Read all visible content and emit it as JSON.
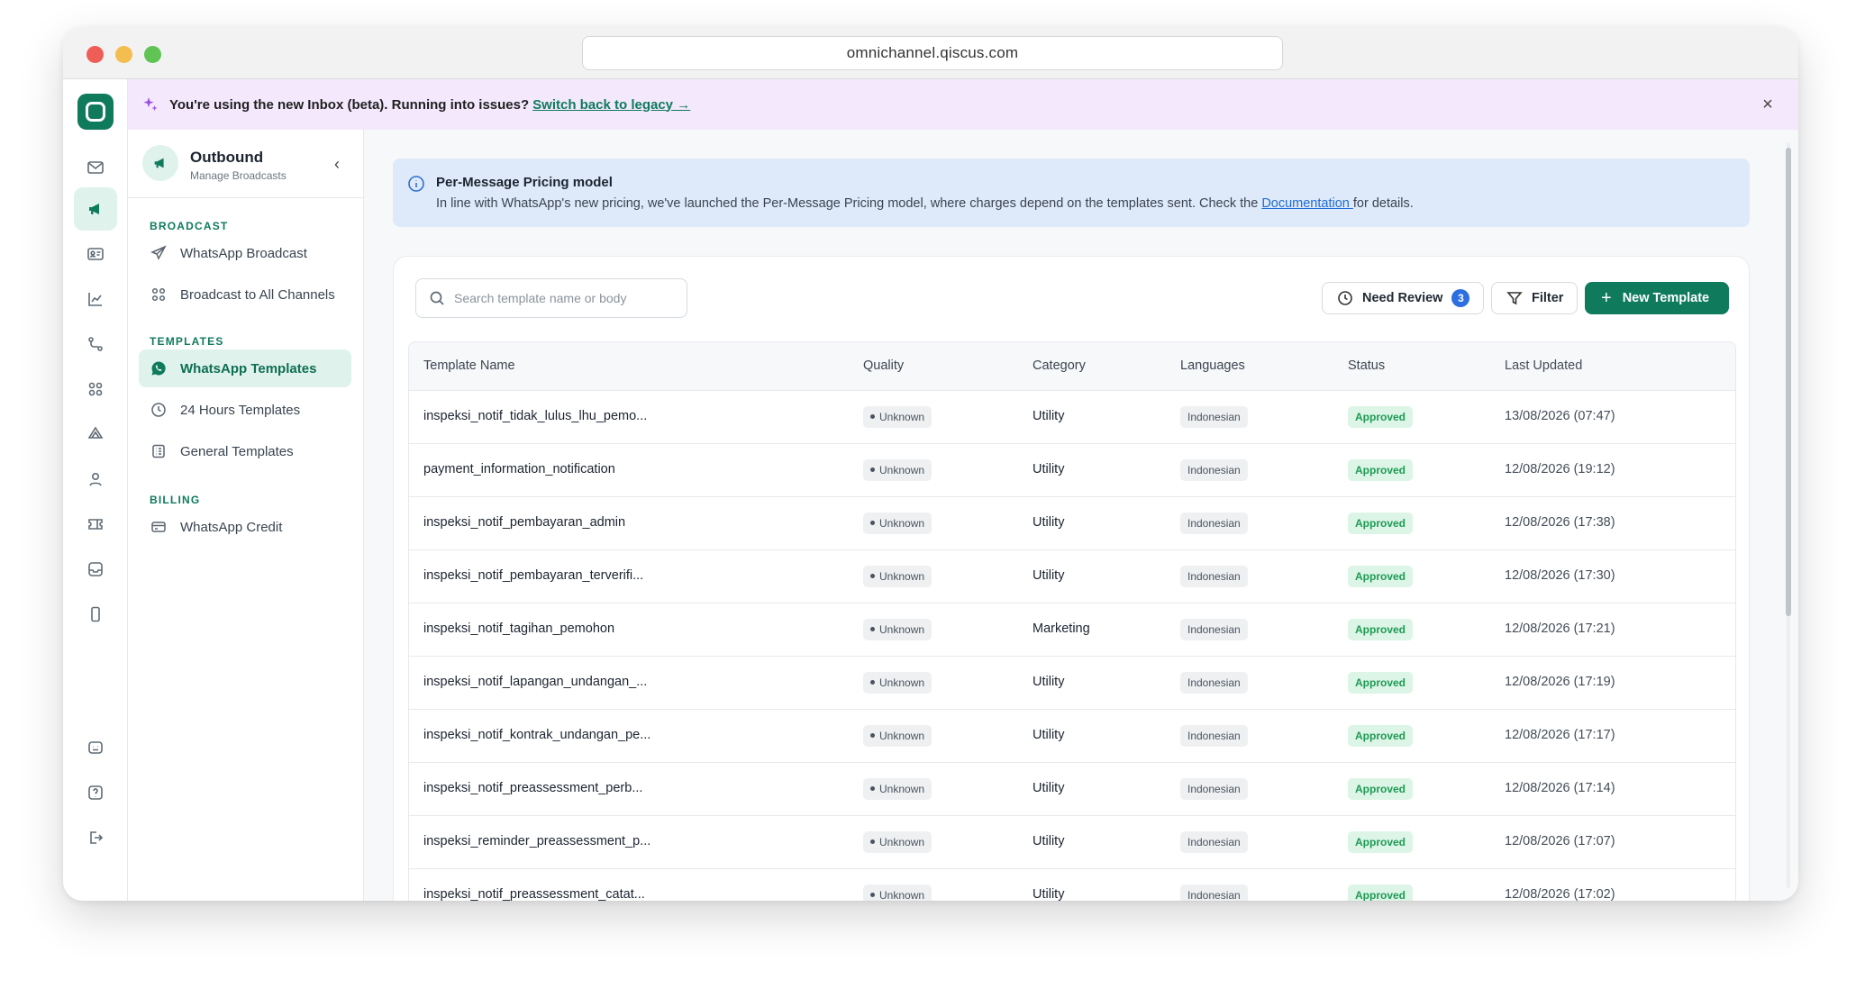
{
  "browser": {
    "url": "omnichannel.qiscus.com"
  },
  "banner": {
    "message": "You're using the new Inbox (beta). Running into issues?",
    "link": "Switch back to legacy →",
    "close": "×"
  },
  "sidebar": {
    "title": "Outbound",
    "subtitle": "Manage Broadcasts",
    "collapse": "‹",
    "sections": {
      "broadcast": "BROADCAST",
      "templates": "TEMPLATES",
      "billing": "BILLING"
    },
    "items": {
      "whatsapp_broadcast": "WhatsApp Broadcast",
      "broadcast_all": "Broadcast to All Channels",
      "whatsapp_templates": "WhatsApp Templates",
      "hours_templates": "24 Hours Templates",
      "general_templates": "General Templates",
      "whatsapp_credit": "WhatsApp Credit"
    }
  },
  "info": {
    "title": "Per-Message Pricing model",
    "text_before": "In line with WhatsApp's new pricing, we've launched the Per-Message Pricing model, where charges depend on the templates sent. Check the ",
    "link": "Documentation ",
    "text_after": "for details."
  },
  "toolbar": {
    "search_placeholder": "Search template name or body",
    "need_review": "Need Review",
    "need_review_count": "3",
    "filter": "Filter",
    "new_template": "New Template",
    "plus": "+"
  },
  "table": {
    "columns": {
      "name": "Template Name",
      "quality": "Quality",
      "category": "Category",
      "languages": "Languages",
      "status": "Status",
      "updated": "Last Updated"
    },
    "rows": [
      {
        "name": "inspeksi_notif_tidak_lulus_lhu_pemo...",
        "quality": "Unknown",
        "category": "Utility",
        "language": "Indonesian",
        "status": "Approved",
        "updated": "13/08/2026 (07:47)"
      },
      {
        "name": "payment_information_notification",
        "quality": "Unknown",
        "category": "Utility",
        "language": "Indonesian",
        "status": "Approved",
        "updated": "12/08/2026 (19:12)"
      },
      {
        "name": "inspeksi_notif_pembayaran_admin",
        "quality": "Unknown",
        "category": "Utility",
        "language": "Indonesian",
        "status": "Approved",
        "updated": "12/08/2026 (17:38)"
      },
      {
        "name": "inspeksi_notif_pembayaran_terverifi...",
        "quality": "Unknown",
        "category": "Utility",
        "language": "Indonesian",
        "status": "Approved",
        "updated": "12/08/2026 (17:30)"
      },
      {
        "name": "inspeksi_notif_tagihan_pemohon",
        "quality": "Unknown",
        "category": "Marketing",
        "language": "Indonesian",
        "status": "Approved",
        "updated": "12/08/2026 (17:21)"
      },
      {
        "name": "inspeksi_notif_lapangan_undangan_...",
        "quality": "Unknown",
        "category": "Utility",
        "language": "Indonesian",
        "status": "Approved",
        "updated": "12/08/2026 (17:19)"
      },
      {
        "name": "inspeksi_notif_kontrak_undangan_pe...",
        "quality": "Unknown",
        "category": "Utility",
        "language": "Indonesian",
        "status": "Approved",
        "updated": "12/08/2026 (17:17)"
      },
      {
        "name": "inspeksi_notif_preassessment_perb...",
        "quality": "Unknown",
        "category": "Utility",
        "language": "Indonesian",
        "status": "Approved",
        "updated": "12/08/2026 (17:14)"
      },
      {
        "name": "inspeksi_reminder_preassessment_p...",
        "quality": "Unknown",
        "category": "Utility",
        "language": "Indonesian",
        "status": "Approved",
        "updated": "12/08/2026 (17:07)"
      },
      {
        "name": "inspeksi_notif_preassessment_catat...",
        "quality": "Unknown",
        "category": "Utility",
        "language": "Indonesian",
        "status": "Approved",
        "updated": "12/08/2026 (17:02)"
      }
    ]
  },
  "colors": {
    "brand": "#0f7a5c",
    "brand_light": "#dff2ec",
    "banner_bg": "#f3e8fc",
    "info_bg": "#deeaf9",
    "badge_blue": "#2d6fe0",
    "approved_bg": "#dcf5e6",
    "approved_text": "#1f9a55"
  },
  "icons": {
    "rail": [
      "inbox-icon",
      "megaphone-icon",
      "contact-card-icon",
      "analytics-icon",
      "workflow-icon",
      "apps-grid-icon",
      "integrations-icon",
      "user-icon",
      "ticket-icon",
      "tray-icon",
      "mobile-icon",
      "chat-bot-icon",
      "help-icon",
      "logout-icon"
    ]
  }
}
